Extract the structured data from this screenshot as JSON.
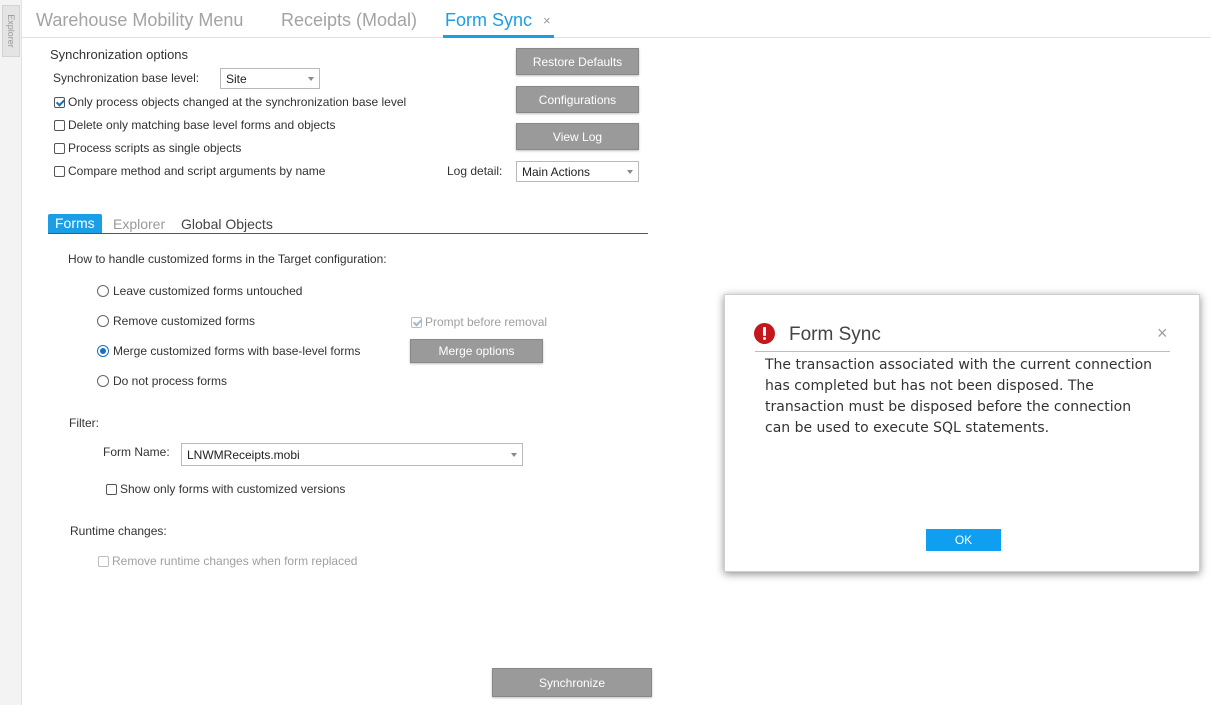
{
  "explorer": {
    "label": "Explorer"
  },
  "doc_tabs": {
    "items": [
      "Warehouse Mobility Menu",
      "Receipts (Modal)",
      "Form Sync"
    ],
    "close_glyph": "×"
  },
  "sync_options": {
    "title": "Synchronization options",
    "base_level_label": "Synchronization base level:",
    "base_level_value": "Site",
    "checks": [
      {
        "label": "Only process objects changed at the synchronization base level",
        "checked": true
      },
      {
        "label": "Delete only matching base level forms and objects",
        "checked": false
      },
      {
        "label": "Process scripts as single objects",
        "checked": false
      },
      {
        "label": "Compare method and script arguments by name",
        "checked": false
      }
    ],
    "log_detail_label": "Log detail:",
    "log_detail_value": "Main Actions"
  },
  "buttons": {
    "restore_defaults": "Restore Defaults",
    "configurations": "Configurations",
    "view_log": "View Log",
    "merge_options": "Merge options",
    "synchronize": "Synchronize"
  },
  "inner_tabs": [
    "Forms",
    "Explorer",
    "Global Objects"
  ],
  "forms_panel": {
    "question": "How to handle customized forms in the Target configuration:",
    "options": [
      {
        "label": "Leave customized forms untouched",
        "selected": false
      },
      {
        "label": "Remove customized forms",
        "selected": false
      },
      {
        "label": "Merge customized forms with base-level forms",
        "selected": true
      },
      {
        "label": "Do not process forms",
        "selected": false
      }
    ],
    "prompt_before_removal": "Prompt before removal",
    "filter_label": "Filter:",
    "form_name_label": "Form Name:",
    "form_name_value": "LNWMReceipts.mobi",
    "show_only_customized": "Show only forms with customized versions",
    "runtime_label": "Runtime changes:",
    "remove_runtime": "Remove runtime changes when form replaced"
  },
  "dialog": {
    "title": "Form Sync",
    "message": "The transaction associated with the current connection\nhas completed but has not been disposed.  The\ntransaction must be disposed before the connection\ncan be used to execute SQL statements.",
    "ok_label": "OK",
    "close_glyph": "×",
    "icon": "error-icon"
  },
  "colors": {
    "accent": "#1a9ee6",
    "ok_button": "#0f9ef0",
    "gray_button": "#9a9a9a",
    "error_red": "#c4161c"
  }
}
